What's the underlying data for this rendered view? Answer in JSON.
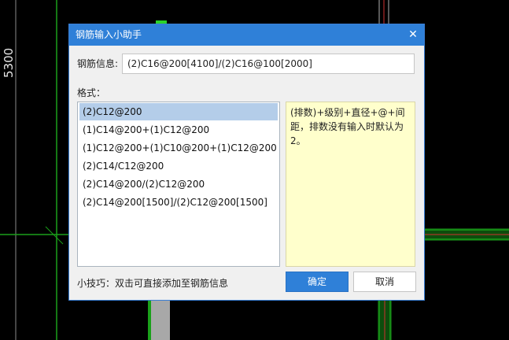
{
  "cad": {
    "dimension_label": "5300"
  },
  "dialog": {
    "title": "钢筋输入小助手",
    "close_glyph": "✕",
    "info_label": "钢筋信息:",
    "info_value": "(2)C16@200[4100]/(2)C16@100[2000]",
    "format_label": "格式：",
    "formats": [
      "(2)C12@200",
      "(1)C14@200+(1)C12@200",
      "(1)C12@200+(1)C10@200+(1)C12@200",
      "(2)C14/C12@200",
      "(2)C14@200/(2)C12@200",
      "(2)C14@200[1500]/(2)C12@200[1500]"
    ],
    "hint": "(排数)+级别+直径+@+间距，排数没有输入时默认为2。",
    "tip": "小技巧：双击可直接添加至钢筋信息",
    "ok_label": "确定",
    "cancel_label": "取消"
  }
}
